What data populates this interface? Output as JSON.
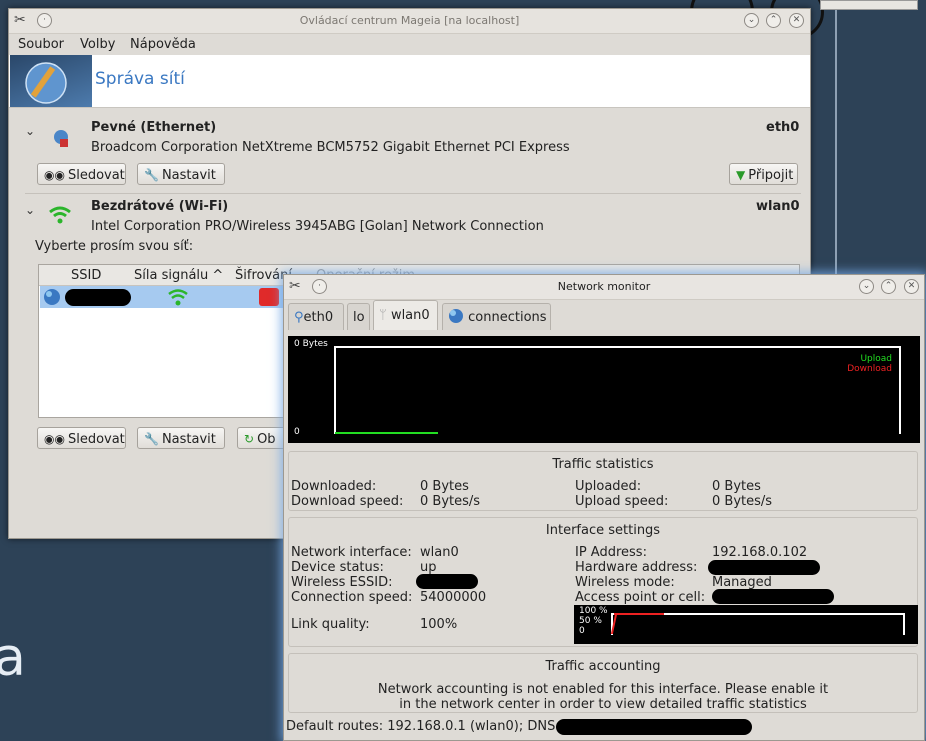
{
  "main_window": {
    "title": "Ovládací centrum Mageia  [na localhost]",
    "menu": [
      "Soubor",
      "Volby",
      "Nápověda"
    ],
    "page_title": "Správa sítí",
    "ethernet": {
      "title": "Pevné (Ethernet)",
      "interface": "eth0",
      "description": "Broadcom Corporation NetXtreme BCM5752 Gigabit Ethernet PCI Express",
      "monitor_label": "Sledovat",
      "configure_label": "Nastavit",
      "connect_label": "Připojit"
    },
    "wifi": {
      "title": "Bezdrátové (Wi-Fi)",
      "interface": "wlan0",
      "description": "Intel Corporation PRO/Wireless 3945ABG [Golan] Network Connection",
      "select_prompt": "Vyberte prosím svou síť:",
      "columns": [
        "SSID",
        "Síla signálu ^",
        "Šifrování",
        "Operační režim"
      ],
      "monitor_label": "Sledovat",
      "configure_label": "Nastavit",
      "refresh_label": "Ob"
    }
  },
  "monitor_window": {
    "title": "Network monitor",
    "tabs": [
      "eth0",
      "lo",
      "wlan0",
      "connections"
    ],
    "graph": {
      "top_label": "0 Bytes",
      "bottom_label": "0",
      "legend_upload": "Upload",
      "legend_download": "Download",
      "upload_color": "#22dd22",
      "download_color": "#ee2222"
    },
    "traffic": {
      "title": "Traffic statistics",
      "downloaded_label": "Downloaded:",
      "downloaded_value": "0 Bytes",
      "download_speed_label": "Download speed:",
      "download_speed_value": "0 Bytes/s",
      "uploaded_label": "Uploaded:",
      "uploaded_value": "0 Bytes",
      "upload_speed_label": "Upload speed:",
      "upload_speed_value": "0 Bytes/s"
    },
    "interface": {
      "title": "Interface settings",
      "network_interface_label": "Network interface:",
      "network_interface_value": "wlan0",
      "device_status_label": "Device status:",
      "device_status_value": "up",
      "essid_label": "Wireless ESSID:",
      "connection_speed_label": "Connection speed:",
      "connection_speed_value": "54000000",
      "link_quality_label": "Link quality:",
      "link_quality_value": "100%",
      "ip_label": "IP Address:",
      "ip_value": "192.168.0.102",
      "hw_label": "Hardware address:",
      "mode_label": "Wireless mode:",
      "mode_value": "Managed",
      "ap_label": "Access point or cell:",
      "quality_graph_labels": [
        "100 %",
        "50 %",
        "0"
      ]
    },
    "accounting": {
      "title": "Traffic accounting",
      "message_line1": "Network accounting is not enabled for this interface. Please enable it",
      "message_line2": "in the network center in order to view detailed traffic statistics"
    },
    "status_bar": "Default routes: 192.168.0.1 (wlan0); DNS:"
  }
}
